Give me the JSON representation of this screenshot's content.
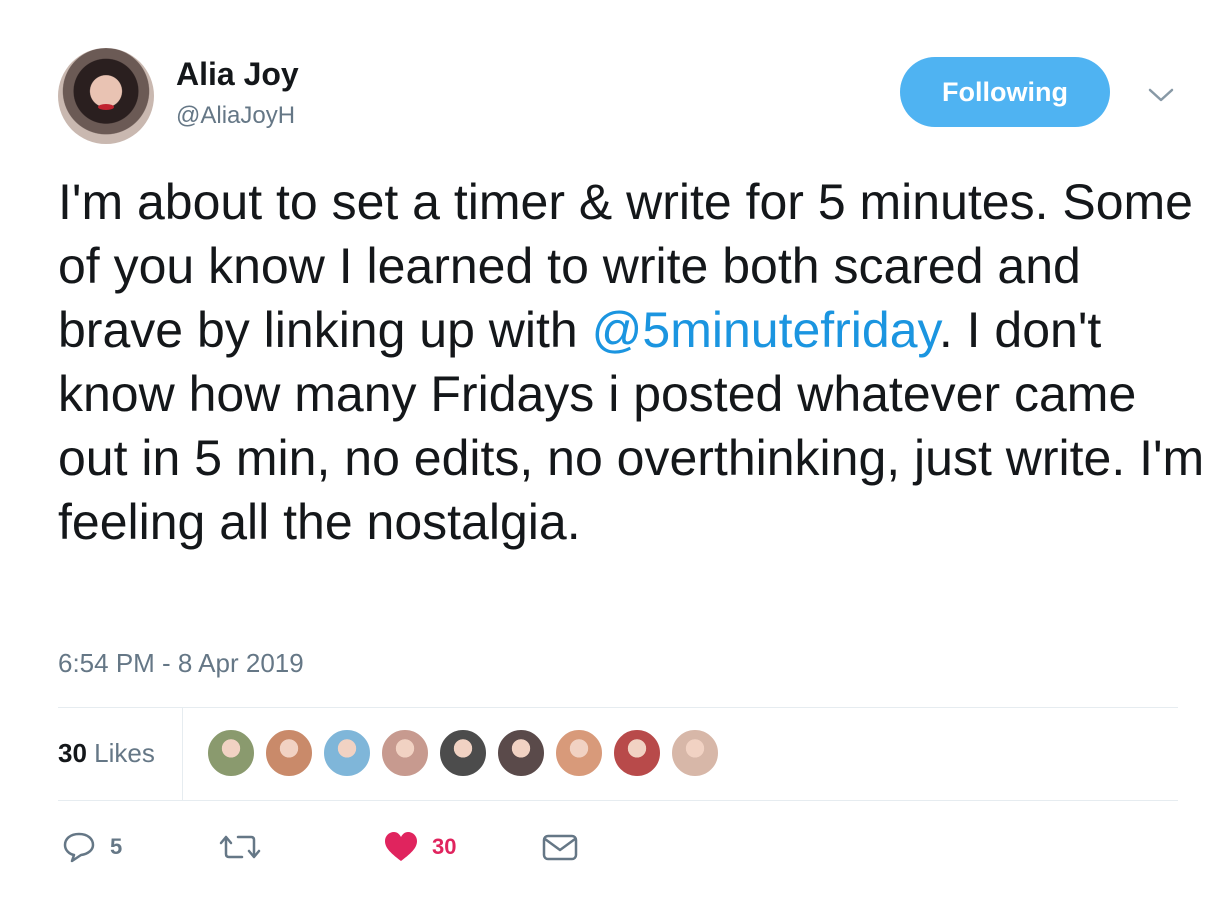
{
  "author": {
    "display_name": "Alia Joy",
    "handle": "@AliaJoyH"
  },
  "follow_button": {
    "label": "Following",
    "color": "#4fb3f2"
  },
  "tweet": {
    "text_before": "I'm about to set a timer & write for 5 minutes. Some of you know I learned to write both scared and brave by linking up with ",
    "mention": "@5minutefriday",
    "text_after": ". I don't know how many Fridays i posted whatever came out in 5 min, no edits, no overthinking, just write. I'm feeling all the nostalgia.",
    "timestamp": "6:54 PM - 8 Apr 2019"
  },
  "likes": {
    "count": "30",
    "label": "Likes",
    "likers": [
      {
        "name": "liker-avatar-1",
        "color": "#8a9a6e"
      },
      {
        "name": "liker-avatar-2",
        "color": "#c98a6a"
      },
      {
        "name": "liker-avatar-3",
        "color": "#7fb6d9"
      },
      {
        "name": "liker-avatar-4",
        "color": "#c79a8f"
      },
      {
        "name": "liker-avatar-5",
        "color": "#4c4c4c"
      },
      {
        "name": "liker-avatar-6",
        "color": "#5a4a4a"
      },
      {
        "name": "liker-avatar-7",
        "color": "#d89a7a"
      },
      {
        "name": "liker-avatar-8",
        "color": "#b84a4a"
      },
      {
        "name": "liker-avatar-9",
        "color": "#d7b7a8"
      }
    ]
  },
  "actions": {
    "reply_count": "5",
    "retweet_count": "",
    "like_count": "30",
    "like_color": "#e0245e"
  }
}
